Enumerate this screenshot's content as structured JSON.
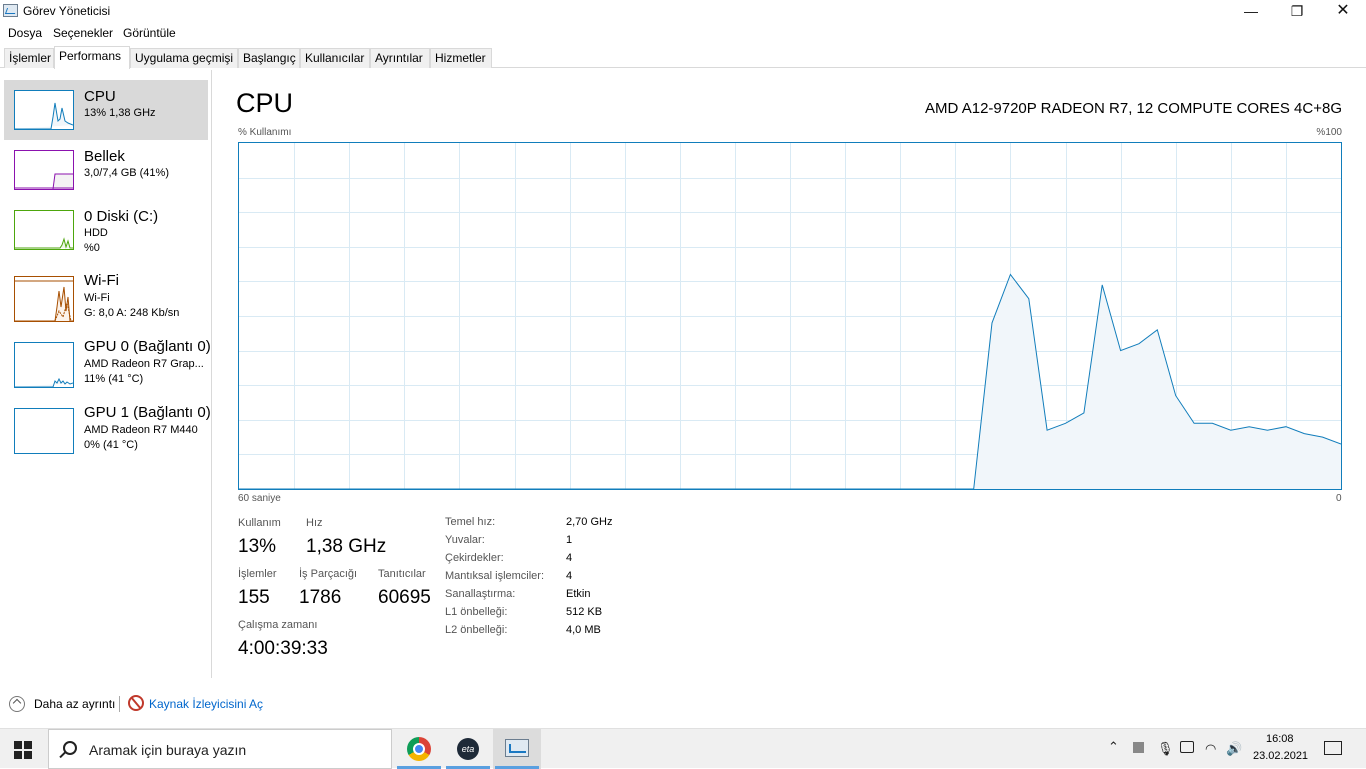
{
  "window": {
    "title": "Görev Yöneticisi",
    "min": "—",
    "max": "❐",
    "close": "✕"
  },
  "menu": [
    "Dosya",
    "Seçenekler",
    "Görüntüle"
  ],
  "tabs": [
    "İşlemler",
    "Performans",
    "Uygulama geçmişi",
    "Başlangıç",
    "Kullanıcılar",
    "Ayrıntılar",
    "Hizmetler"
  ],
  "sidebar": [
    {
      "title": "CPU",
      "line1": "13% 1,38 GHz",
      "line2": "",
      "line3": "",
      "color": "#117dbb",
      "fill": "#f1f6fa"
    },
    {
      "title": "Bellek",
      "line1": "3,0/7,4 GB (41%)",
      "line2": "",
      "line3": "",
      "color": "#8b12ae",
      "fill": "#f4f2f4"
    },
    {
      "title": "0 Diski (C:)",
      "line1": "HDD",
      "line2": "%0",
      "line3": "",
      "color": "#4da60c",
      "fill": "#eff7e8"
    },
    {
      "title": "Wi-Fi",
      "line1": "Wi-Fi",
      "line2": "G: 8,0  A: 248 Kb/sn",
      "line3": "",
      "color": "#a74f01",
      "fill": "#fcf3eb"
    },
    {
      "title": "GPU 0 (Bağlantı 0)",
      "line1": "AMD Radeon R7 Grap...",
      "line2": "11% (41 °C)",
      "line3": "",
      "color": "#117dbb",
      "fill": "#f1f6fa"
    },
    {
      "title": "GPU 1 (Bağlantı 0)",
      "line1": "AMD Radeon R7 M440",
      "line2": "0% (41 °C)",
      "line3": "",
      "color": "#117dbb",
      "fill": "#f1f6fa"
    }
  ],
  "main": {
    "title": "CPU",
    "processor": "AMD A12-9720P RADEON R7, 12 COMPUTE CORES 4C+8G",
    "usage_label": "% Kullanımı",
    "max_label": "%100",
    "time_label": "60 saniye",
    "min_label": "0"
  },
  "chart_data": {
    "type": "area",
    "x_unit": "seconds",
    "x": [
      0,
      1,
      2,
      3,
      4,
      5,
      6,
      7,
      8,
      9,
      10,
      11,
      12,
      13,
      14,
      15,
      16,
      17,
      18,
      19,
      20,
      21,
      22,
      23,
      24,
      25,
      26,
      27,
      28,
      29,
      30,
      31,
      32,
      33,
      34,
      35,
      36,
      37,
      38,
      39,
      40,
      41,
      42,
      43,
      44,
      45,
      46,
      47,
      48,
      49,
      50,
      51,
      52,
      53,
      54,
      55,
      56,
      57,
      58,
      59,
      60
    ],
    "values": [
      0,
      0,
      0,
      0,
      0,
      0,
      0,
      0,
      0,
      0,
      0,
      0,
      0,
      0,
      0,
      0,
      0,
      0,
      0,
      0,
      0,
      0,
      0,
      0,
      0,
      0,
      0,
      0,
      0,
      0,
      0,
      0,
      0,
      0,
      0,
      0,
      0,
      0,
      0,
      0,
      0,
      48,
      62,
      55,
      17,
      19,
      22,
      59,
      40,
      42,
      46,
      27,
      19,
      19,
      17,
      18,
      17,
      18,
      16,
      15,
      13
    ],
    "ylim": [
      0,
      100
    ],
    "xlim": [
      0,
      60
    ],
    "ylabel": "% Kullanımı",
    "grid": true,
    "color": "#117dbb",
    "fill": "#f1f6fa"
  },
  "stats": {
    "usage_lbl": "Kullanım",
    "usage_val": "13%",
    "speed_lbl": "Hız",
    "speed_val": "1,38 GHz",
    "proc_lbl": "İşlemler",
    "proc_val": "155",
    "threads_lbl": "İş Parçacığı",
    "threads_val": "1786",
    "handles_lbl": "Tanıtıcılar",
    "handles_val": "60695",
    "uptime_lbl": "Çalışma zamanı",
    "uptime_val": "4:00:39:33"
  },
  "details": [
    {
      "label": "Temel hız:",
      "value": "2,70 GHz"
    },
    {
      "label": "Yuvalar:",
      "value": "1"
    },
    {
      "label": "Çekirdekler:",
      "value": "4"
    },
    {
      "label": "Mantıksal işlemciler:",
      "value": "4"
    },
    {
      "label": "Sanallaştırma:",
      "value": "Etkin"
    },
    {
      "label": "L1 önbelleği:",
      "value": "512 KB"
    },
    {
      "label": "L2 önbelleği:",
      "value": "4,0 MB"
    }
  ],
  "footer": {
    "less_details": "Daha az ayrıntı",
    "resource_monitor": "Kaynak İzleyicisini Aç"
  },
  "taskbar": {
    "search_placeholder": "Aramak için buraya yazın",
    "eta_label": "eta",
    "time": "16:08",
    "date": "23.02.2021"
  }
}
